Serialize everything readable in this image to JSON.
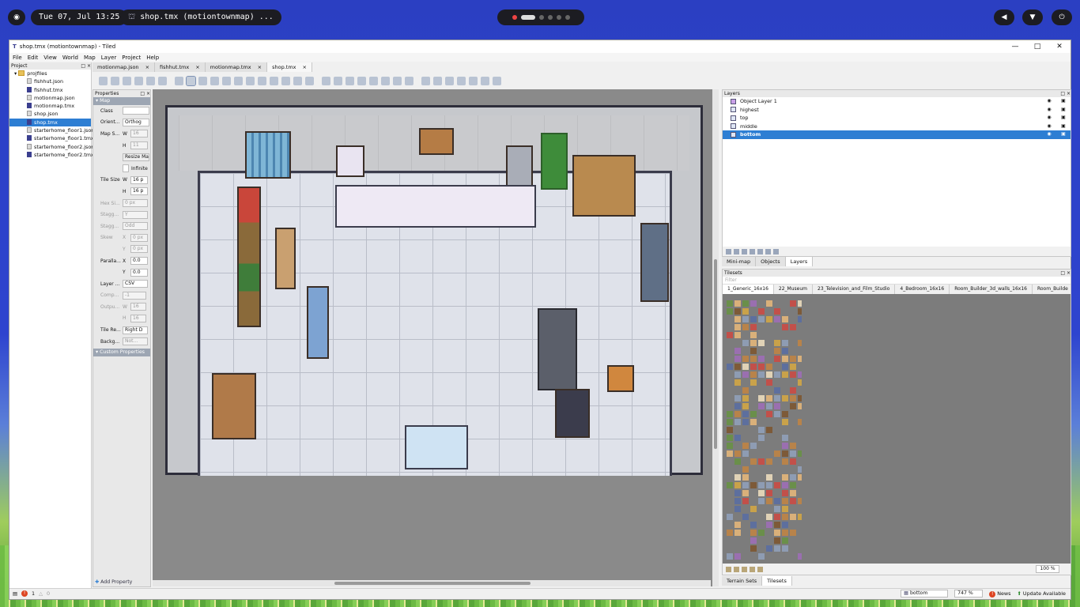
{
  "topbar": {
    "clock": "Tue 07, Jul 13:25",
    "window_title": "shop.tmx (motiontownmap) ...",
    "workspace_dots": 6
  },
  "window": {
    "title": "shop.tmx (motiontownmap) - Tiled",
    "controls": {
      "minimize": "—",
      "maximize": "□",
      "close": "✕"
    }
  },
  "menu": [
    "File",
    "Edit",
    "View",
    "World",
    "Map",
    "Layer",
    "Project",
    "Help"
  ],
  "project": {
    "header": "Project",
    "root": "projfiles",
    "files": [
      {
        "name": "fishhut.json",
        "type": "json"
      },
      {
        "name": "fishhut.tmx",
        "type": "tmx"
      },
      {
        "name": "motionmap.json",
        "type": "json"
      },
      {
        "name": "motionmap.tmx",
        "type": "tmx"
      },
      {
        "name": "shop.json",
        "type": "json"
      },
      {
        "name": "shop.tmx",
        "type": "tmx",
        "selected": true
      },
      {
        "name": "starterhome_floor1.json",
        "type": "json"
      },
      {
        "name": "starterhome_floor1.tmx",
        "type": "tmx"
      },
      {
        "name": "starterhome_floor2.json",
        "type": "json"
      },
      {
        "name": "starterhome_floor2.tmx",
        "type": "tmx"
      }
    ]
  },
  "tabs": [
    {
      "label": "motionmap.json"
    },
    {
      "label": "fishhut.tmx"
    },
    {
      "label": "motionmap.tmx"
    },
    {
      "label": "shop.tmx",
      "active": true
    }
  ],
  "properties": {
    "header": "Properties",
    "section_map": "Map",
    "class_label": "Class",
    "orientation_label": "Orient...",
    "orientation_value": "Orthog",
    "map_size_label": "Map S...",
    "map_w": "16",
    "map_h": "11",
    "resize_label": "Resize Map",
    "infinite_label": "Infinite",
    "tile_size_label": "Tile Size",
    "tile_w": "16 p",
    "tile_h": "16 p",
    "hex_label": "Hex Si...",
    "hex_value": "0 px",
    "stagger_axis_label": "Stagg...",
    "stagger_axis_value": "Y",
    "stagger_index_label": "Stagg...",
    "stagger_index_value": "Odd",
    "skew_label": "Skew",
    "skew_x": "0 px",
    "skew_y": "0 px",
    "parallax_label": "Paralla...",
    "parallax_x": "0.0",
    "parallax_y": "0.0",
    "layer_format_label": "Layer ...",
    "layer_format_value": "CSV",
    "compression_label": "Comp...",
    "compression_value": "-1",
    "output_label": "Outpu...",
    "output_w": "16",
    "output_h": "16",
    "render_order_label": "Tile Re...",
    "render_order_value": "Right D",
    "background_label": "Backg...",
    "background_value": "Not...",
    "custom_section": "Custom Properties",
    "add_property": "Add Property",
    "x_lbl": "X",
    "y_lbl": "Y",
    "w_lbl": "W",
    "h_lbl": "H"
  },
  "layers": {
    "header": "Layers",
    "items": [
      {
        "name": "Object Layer 1",
        "kind": "object"
      },
      {
        "name": "highest",
        "kind": "tile"
      },
      {
        "name": "top",
        "kind": "tile"
      },
      {
        "name": "middle",
        "kind": "tile"
      },
      {
        "name": "bottom",
        "kind": "tile",
        "selected": true
      }
    ]
  },
  "right_tabs": [
    {
      "label": "Mini-map"
    },
    {
      "label": "Objects"
    },
    {
      "label": "Layers",
      "active": true
    }
  ],
  "tilesets": {
    "header": "Tilesets",
    "filter_placeholder": "Filter",
    "tabs": [
      "1_Generic_16x16",
      "22_Museum",
      "23_Television_and_Film_Studio",
      "4_Bedroom_16x16",
      "Room_Builder_3d_walls_16x16",
      "Room_Builde"
    ],
    "zoom": "100 %"
  },
  "bottom_tabs": [
    {
      "label": "Terrain Sets"
    },
    {
      "label": "Tilesets",
      "active": true
    }
  ],
  "status": {
    "errors": "1",
    "warnings": "0",
    "layer_select": "bottom",
    "zoom": "747 %",
    "news": "News",
    "update": "Update Available"
  }
}
